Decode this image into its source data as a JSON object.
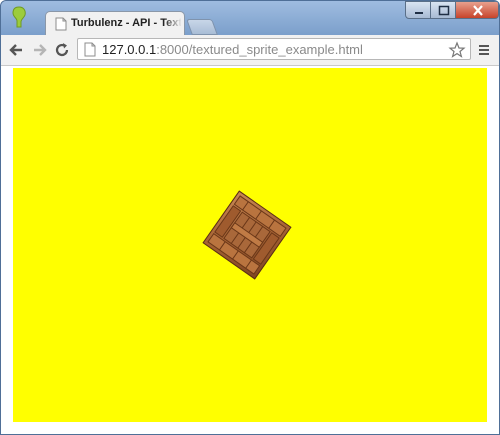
{
  "window": {
    "tab": {
      "title": "Turbulenz - API - Textured Sprite Example",
      "icon": "document-icon"
    },
    "controls": [
      "minimize-icon",
      "maximize-icon",
      "close-icon"
    ]
  },
  "toolbar": {
    "back_icon": "back-arrow-icon",
    "forward_icon": "forward-arrow-icon",
    "reload_icon": "reload-icon",
    "url_host": "127.0.0.1",
    "url_rest": ":8000/textured_sprite_example.html",
    "bookmark_icon": "star-icon",
    "menu_icon": "menu-icon"
  },
  "page": {
    "canvas_color": "#ffff00",
    "sprite": {
      "name": "wooden crate",
      "rotation_deg": 35
    }
  }
}
